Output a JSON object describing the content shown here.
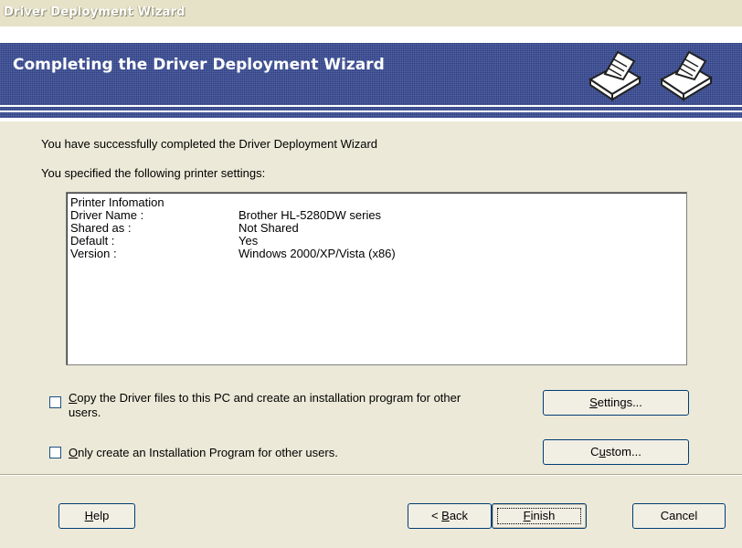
{
  "window": {
    "title": "Driver Deployment Wizard"
  },
  "banner": {
    "heading": "Completing the Driver Deployment Wizard",
    "icons": [
      "printer-icon",
      "printer-icon"
    ]
  },
  "body": {
    "success_text": "You have successfully completed the Driver Deployment Wizard",
    "settings_intro": "You specified the following printer settings:"
  },
  "settings_list": {
    "header": "Printer Infomation",
    "rows": [
      {
        "key": "Driver Name :",
        "value": "Brother HL-5280DW series"
      },
      {
        "key": "Shared as :",
        "value": "Not Shared"
      },
      {
        "key": "Default :",
        "value": "Yes"
      },
      {
        "key": "Version :",
        "value": "Windows 2000/XP/Vista (x86)"
      }
    ]
  },
  "options": {
    "copy_files": {
      "label_line1_lead": "C",
      "label_line1_rest": "opy the Driver files to this PC and create an installation program for other",
      "label_line2": "users.",
      "checked": false
    },
    "only_create": {
      "label_lead": "O",
      "label_rest": "nly create an Installation Program for other users.",
      "checked": false
    }
  },
  "buttons": {
    "settings": {
      "lead": "S",
      "rest": "ettings..."
    },
    "custom": {
      "pre": "C",
      "accel": "u",
      "post": "stom..."
    },
    "help": {
      "lead": "H",
      "rest": "elp"
    },
    "back": {
      "pre": "< ",
      "accel": "B",
      "post": "ack"
    },
    "finish": {
      "lead": "F",
      "rest": "inish"
    },
    "cancel": {
      "label": "Cancel"
    }
  },
  "colors": {
    "banner": "#2d3f87",
    "dialog": "#ece9d8"
  }
}
